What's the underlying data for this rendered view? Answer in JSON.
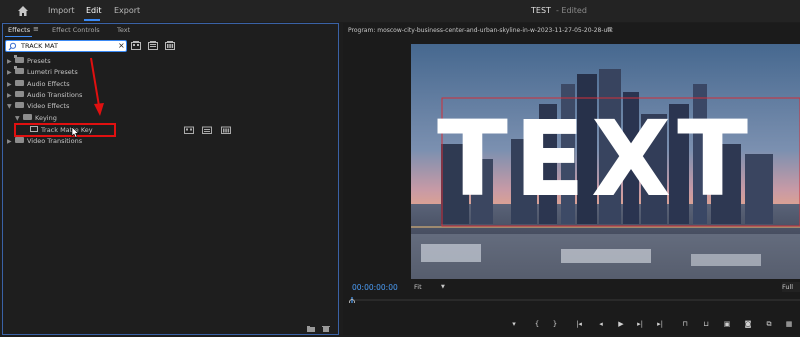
{
  "topnav": {
    "items": [
      "Import",
      "Edit",
      "Export"
    ],
    "active_index": 1,
    "project_title": "TEST",
    "project_status": "- Edited"
  },
  "effects_panel": {
    "tabs": [
      "Effects",
      "Effect Controls",
      "Text"
    ],
    "active_tab": "Effects",
    "search_value": "TRACK MAT",
    "tree": [
      {
        "label": "Presets",
        "icon": "folder-star-icon",
        "expanded": false
      },
      {
        "label": "Lumetri Presets",
        "icon": "folder-star-icon",
        "expanded": false
      },
      {
        "label": "Audio Effects",
        "icon": "folder-icon",
        "expanded": false
      },
      {
        "label": "Audio Transitions",
        "icon": "folder-icon",
        "expanded": false
      },
      {
        "label": "Video Effects",
        "icon": "folder-icon",
        "expanded": true
      },
      {
        "label": "Keying",
        "icon": "folder-icon",
        "expanded": true
      },
      {
        "label": "Track Matte Key",
        "icon": "effect-icon",
        "expanded": false
      },
      {
        "label": "Video Transitions",
        "icon": "folder-icon",
        "expanded": false
      }
    ]
  },
  "program_monitor": {
    "title": "Program: moscow-city-business-center-and-urban-skyline-in-w-2023-11-27-05-20-28-utc",
    "overlay_text": "TEXT",
    "timecode": "00:00:00:00",
    "zoom": "Fit",
    "resolution": "Full"
  },
  "colors": {
    "accent": "#3b8af5",
    "highlight": "#e01010",
    "timecode": "#4b9cf5"
  }
}
